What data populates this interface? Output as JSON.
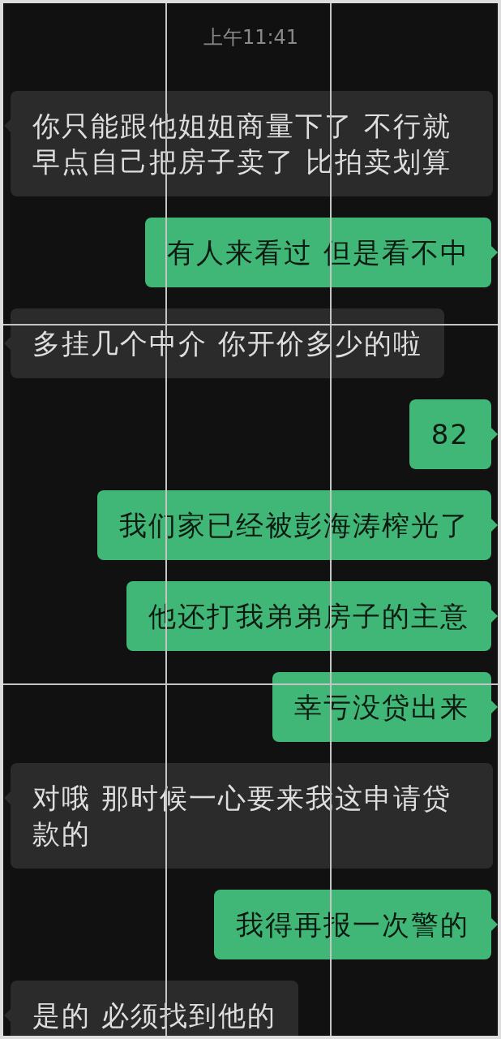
{
  "timestamp": "上午11:41",
  "messages": [
    {
      "kind": "received",
      "text": "你只能跟他姐姐商量下了 不行就早点自己把房子卖了 比拍卖划算"
    },
    {
      "kind": "sent",
      "text": "有人来看过 但是看不中"
    },
    {
      "kind": "received",
      "text": "多挂几个中介 你开价多少的啦"
    },
    {
      "kind": "sent",
      "text": "82"
    },
    {
      "kind": "sent",
      "text": "我们家已经被彭海涛榨光了"
    },
    {
      "kind": "sent",
      "text": "他还打我弟弟房子的主意"
    },
    {
      "kind": "sent",
      "text": "幸亏没贷出来"
    },
    {
      "kind": "received",
      "text": "对哦 那时候一心要来我这申请贷款的"
    },
    {
      "kind": "sent",
      "text": "我得再报一次警的"
    },
    {
      "kind": "received",
      "text": "是的 必须找到他的"
    }
  ]
}
